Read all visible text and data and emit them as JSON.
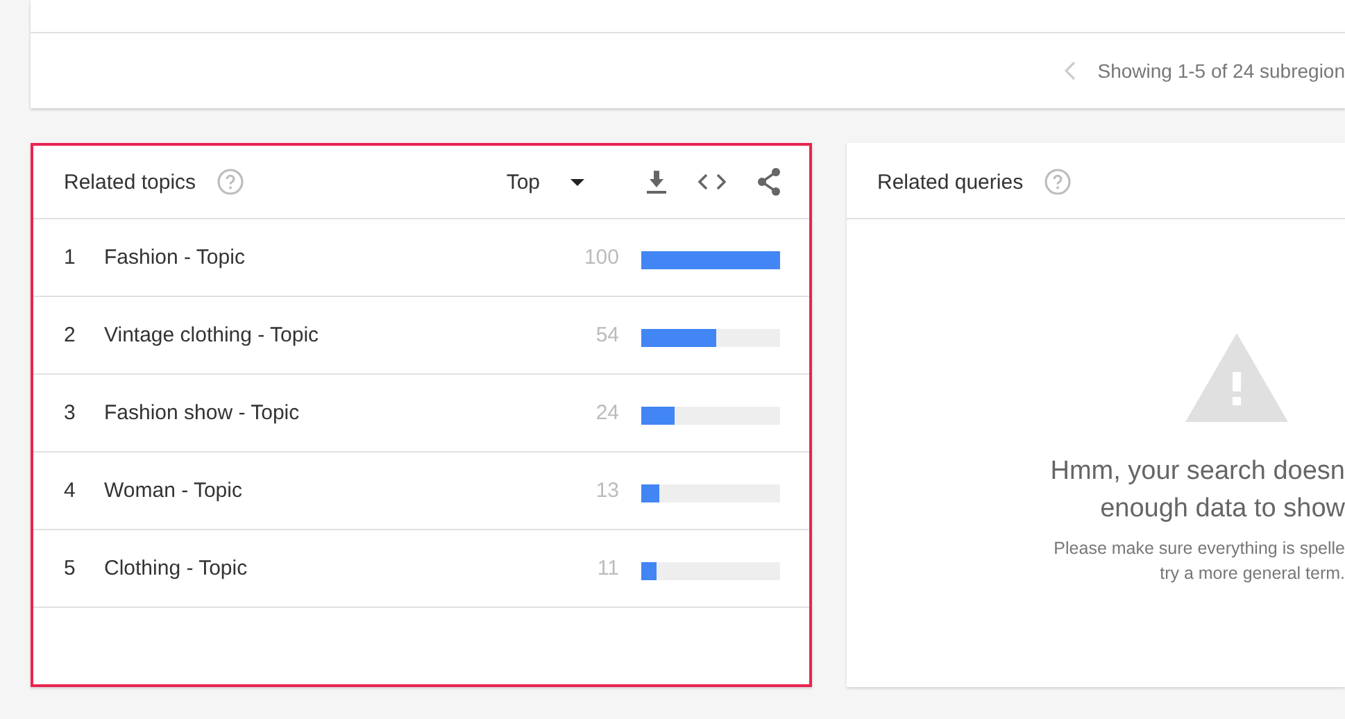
{
  "top_card": {
    "pagination": {
      "prev_disabled": true,
      "text": "Showing 1-5 of 24 subregion"
    }
  },
  "related_topics": {
    "title": "Related topics",
    "highlighted": true,
    "filter": "Top",
    "rows": [
      {
        "rank": "1",
        "label": "Fashion - Topic",
        "value": "100",
        "level": 1.0
      },
      {
        "rank": "2",
        "label": "Vintage clothing - Topic",
        "value": "54",
        "level": 0.54
      },
      {
        "rank": "3",
        "label": "Fashion show - Topic",
        "value": "24",
        "level": 0.24
      },
      {
        "rank": "4",
        "label": "Woman - Topic",
        "value": "13",
        "level": 0.13
      },
      {
        "rank": "5",
        "label": "Clothing - Topic",
        "value": "11",
        "level": 0.11
      }
    ]
  },
  "related_queries": {
    "title": "Related queries",
    "message": [
      "Hmm, your search doesn",
      "enough data to show"
    ],
    "hint": [
      "Please make sure everything is spelle",
      "try a more general term."
    ]
  }
}
